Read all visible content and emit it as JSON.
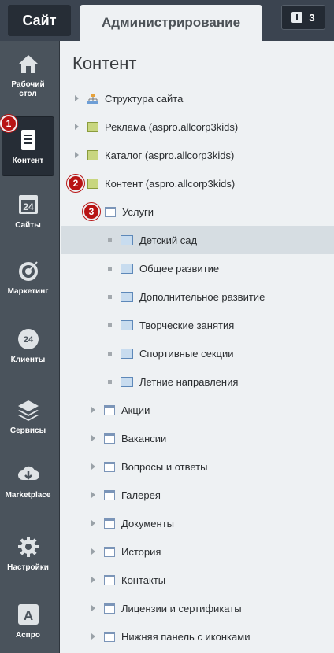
{
  "topbar": {
    "tab_site": "Сайт",
    "tab_admin": "Администрирование",
    "notifications_count": "3",
    "notification_icon": "info-icon"
  },
  "sidebar": {
    "items": [
      {
        "label_line1": "Рабочий",
        "label_line2": "стол",
        "icon": "home-icon"
      },
      {
        "label": "Контент",
        "icon": "document-icon",
        "active": true,
        "badge": "1"
      },
      {
        "label": "Сайты",
        "icon": "calendar-icon",
        "icon_text": "24"
      },
      {
        "label": "Маркетинг",
        "icon": "target-icon"
      },
      {
        "label": "Клиенты",
        "icon": "clients-icon",
        "icon_text": "24"
      },
      {
        "label": "Сервисы",
        "icon": "layers-icon"
      },
      {
        "label": "Marketplace",
        "icon": "cloud-download-icon"
      },
      {
        "label": "Настройки",
        "icon": "gear-icon"
      },
      {
        "label": "Аспро",
        "icon": "aspro-icon",
        "icon_text": "A"
      }
    ]
  },
  "main": {
    "title": "Контент",
    "tree": [
      {
        "label": "Структура сайта",
        "icon": "sitemap-icon"
      },
      {
        "label": "Реклама (aspro.allcorp3kids)",
        "icon": "iblock-type-icon"
      },
      {
        "label": "Каталог (aspro.allcorp3kids)",
        "icon": "iblock-type-icon"
      },
      {
        "label": "Контент (aspro.allcorp3kids)",
        "icon": "iblock-type-icon",
        "badge": "2"
      },
      {
        "label": "Услуги",
        "icon": "iblock-icon",
        "badge": "3"
      },
      {
        "label": "Детский сад",
        "icon": "folder-icon"
      },
      {
        "label": "Общее развитие",
        "icon": "folder-icon"
      },
      {
        "label": "Дополнительное развитие",
        "icon": "folder-icon"
      },
      {
        "label": "Творческие занятия",
        "icon": "folder-icon"
      },
      {
        "label": "Спортивные секции",
        "icon": "folder-icon"
      },
      {
        "label": "Летние направления",
        "icon": "folder-icon"
      },
      {
        "label": "Акции",
        "icon": "iblock-icon"
      },
      {
        "label": "Вакансии",
        "icon": "iblock-icon"
      },
      {
        "label": "Вопросы и ответы",
        "icon": "iblock-icon"
      },
      {
        "label": "Галерея",
        "icon": "iblock-icon"
      },
      {
        "label": "Документы",
        "icon": "iblock-icon"
      },
      {
        "label": "История",
        "icon": "iblock-icon"
      },
      {
        "label": "Контакты",
        "icon": "iblock-icon"
      },
      {
        "label": "Лицензии и сертификаты",
        "icon": "iblock-icon"
      },
      {
        "label": "Нижняя панель с иконками",
        "icon": "iblock-icon"
      }
    ]
  },
  "colors": {
    "sidebar_bg": "#4a535c",
    "topbar_bg": "#3b4450",
    "badge": "#b81414",
    "selected_row": "#d6dde2"
  }
}
